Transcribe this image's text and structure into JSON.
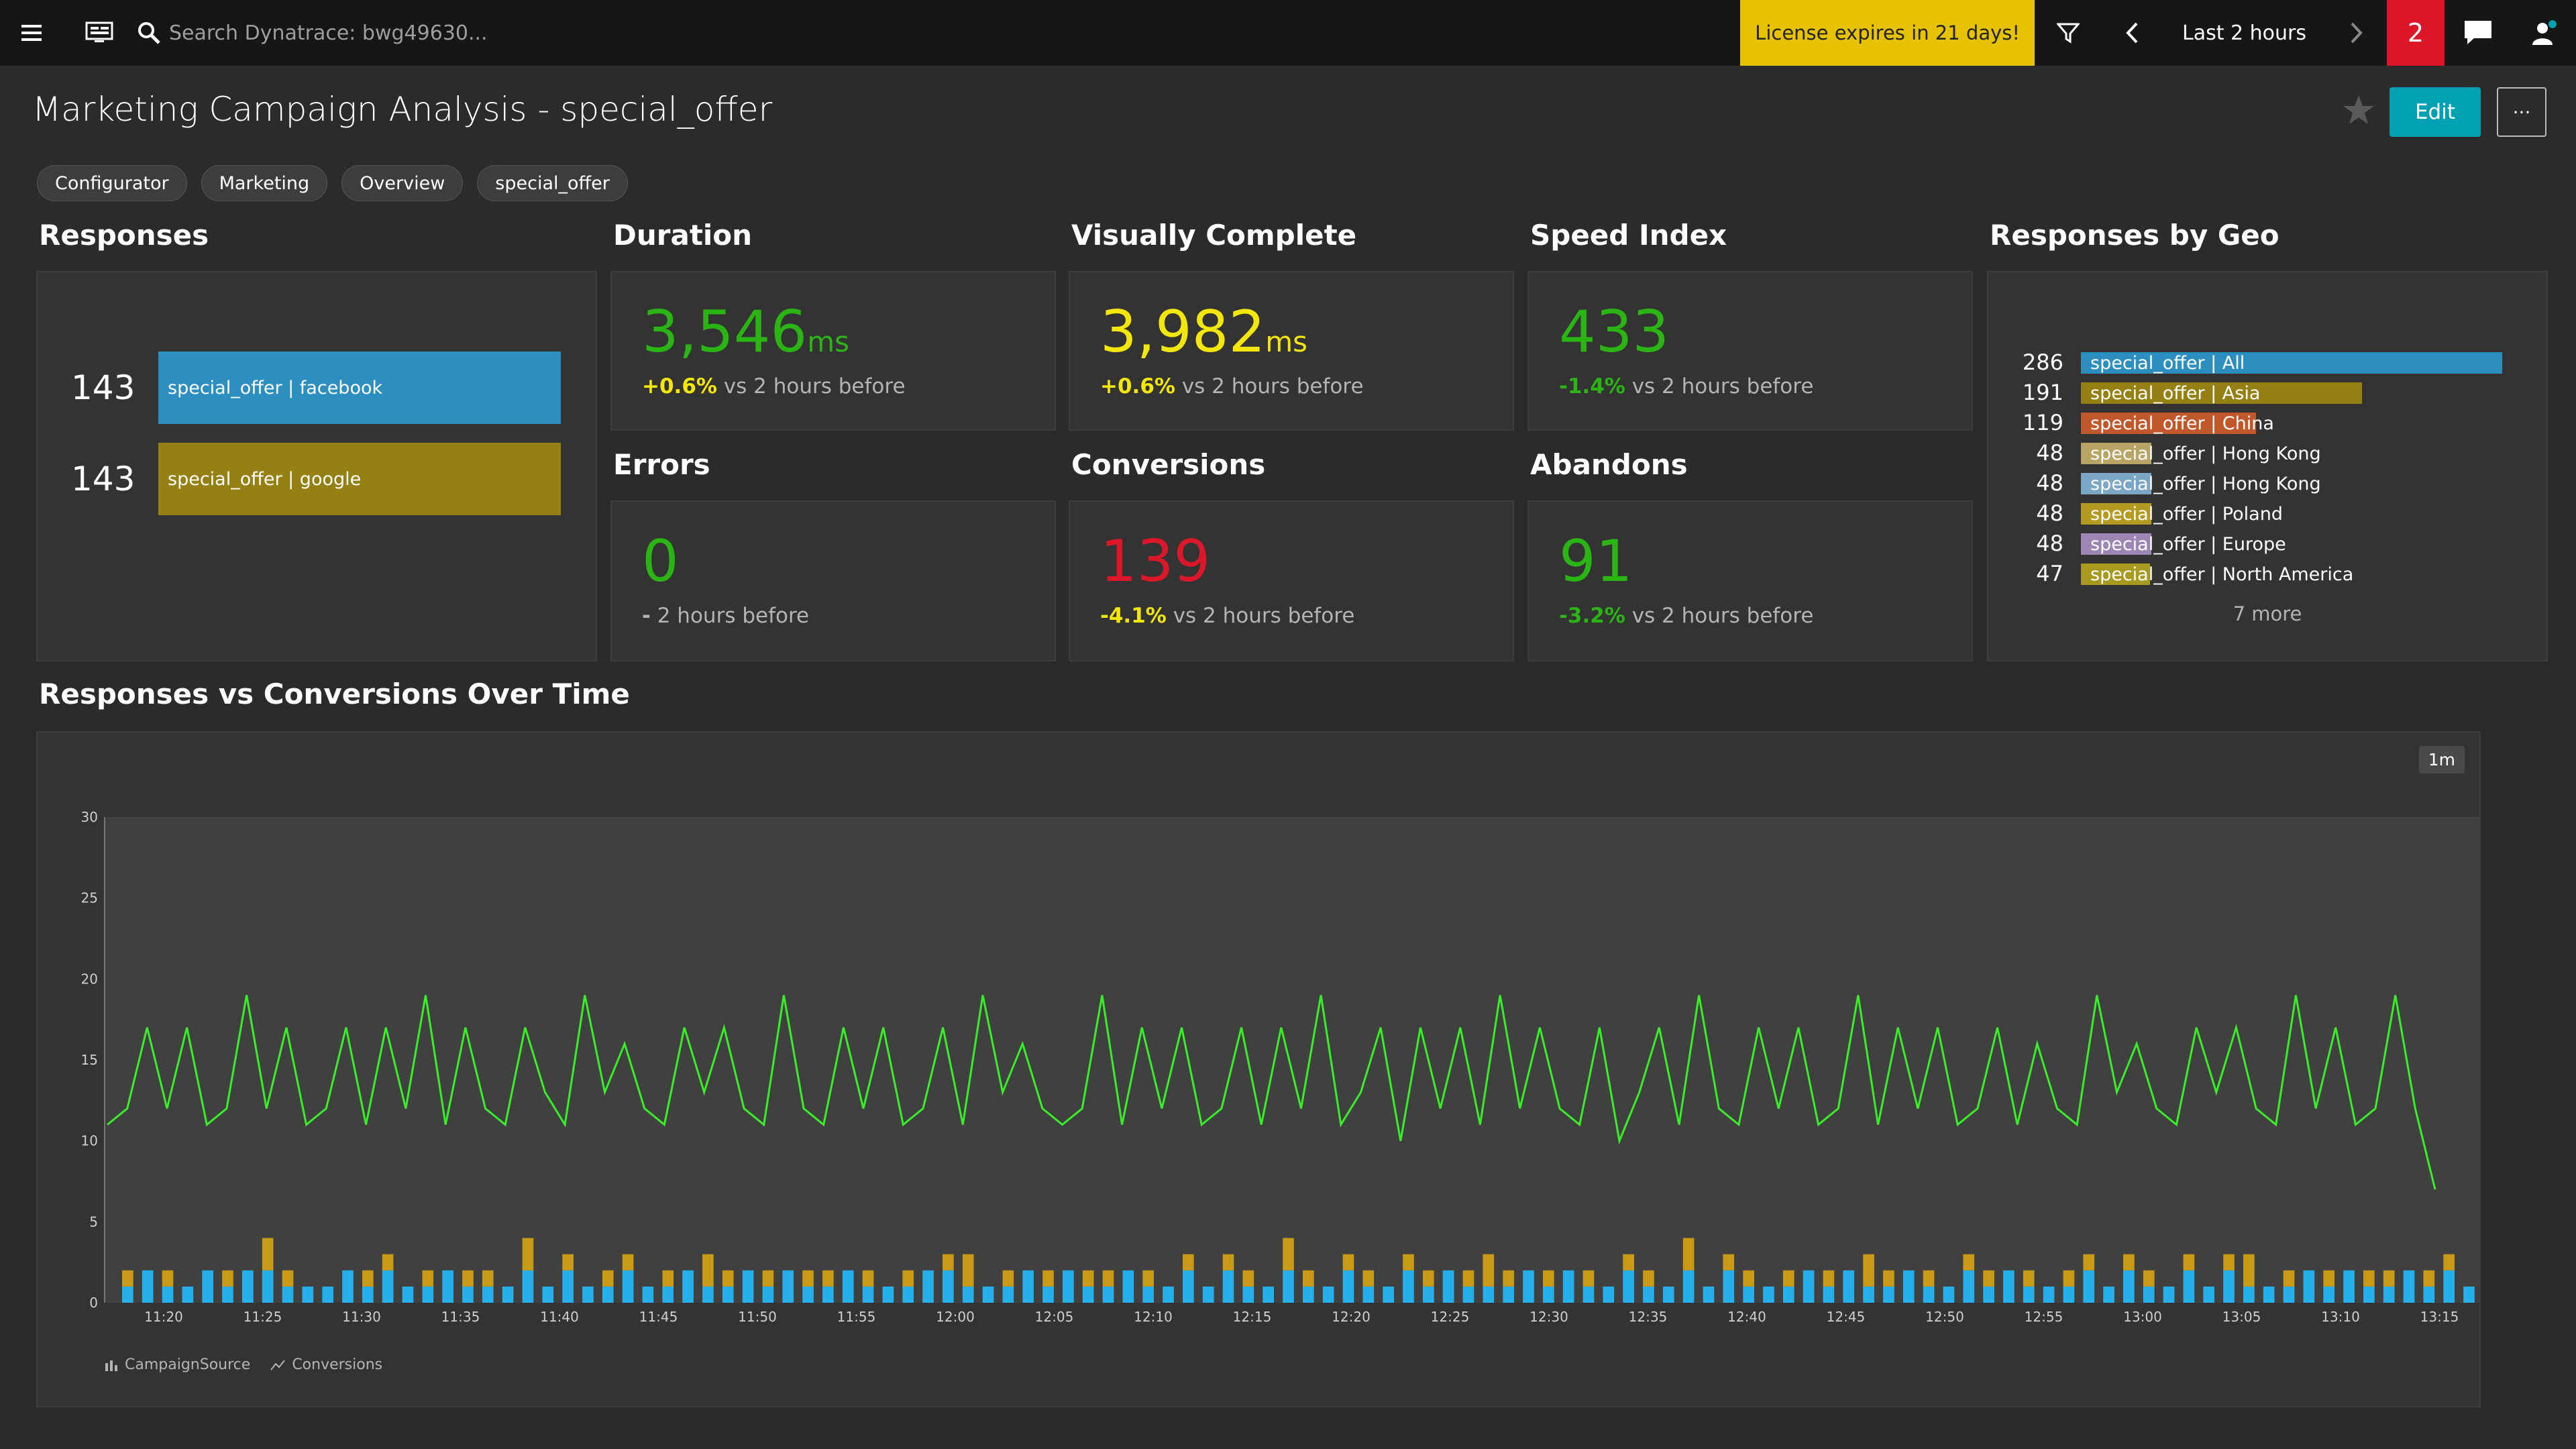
{
  "header": {
    "search_placeholder": "Search Dynatrace: bwg49630...",
    "license_text": "License expires in 21 days!",
    "timeframe": "Last 2 hours",
    "notification_count": "2"
  },
  "page": {
    "title": "Marketing Campaign Analysis - special_offer",
    "edit_label": "Edit",
    "more_label": "···",
    "tags": [
      "Configurator",
      "Marketing",
      "Overview",
      "special_offer"
    ]
  },
  "colors": {
    "accent": "#00a1b2",
    "green": "#2ab515",
    "yellow": "#f3e60b",
    "red": "#dc172a",
    "license": "#e6c200",
    "bar_blue": "#2d8fbf",
    "bar_gold": "#958013"
  },
  "responses": {
    "title": "Responses",
    "rows": [
      {
        "count": "143",
        "label": "special_offer | facebook",
        "color": "#2d8fbf"
      },
      {
        "count": "143",
        "label": "special_offer | google",
        "color": "#958013"
      }
    ]
  },
  "metrics": {
    "duration": {
      "title": "Duration",
      "value": "3,546",
      "unit": "ms",
      "delta": "+0.6%",
      "delta_text": "vs 2 hours before",
      "value_color": "#2ab515",
      "delta_color": "#f3e60b"
    },
    "visually_complete": {
      "title": "Visually Complete",
      "value": "3,982",
      "unit": "ms",
      "delta": "+0.6%",
      "delta_text": "vs 2 hours before",
      "value_color": "#f3e60b",
      "delta_color": "#f3e60b"
    },
    "speed_index": {
      "title": "Speed Index",
      "value": "433",
      "unit": "",
      "delta": "-1.4%",
      "delta_text": "vs 2 hours before",
      "value_color": "#2ab515",
      "delta_color": "#2ab515"
    },
    "errors": {
      "title": "Errors",
      "value": "0",
      "unit": "",
      "delta": "-",
      "delta_text": "2 hours before",
      "value_color": "#2ab515",
      "delta_color": "#b4b4b4"
    },
    "conversions": {
      "title": "Conversions",
      "value": "139",
      "unit": "",
      "delta": "-4.1%",
      "delta_text": "vs 2 hours before",
      "value_color": "#dc172a",
      "delta_color": "#f3e60b"
    },
    "abandons": {
      "title": "Abandons",
      "value": "91",
      "unit": "",
      "delta": "-3.2%",
      "delta_text": "vs 2 hours before",
      "value_color": "#2ab515",
      "delta_color": "#2ab515"
    }
  },
  "geo": {
    "title": "Responses by Geo",
    "more": "7 more",
    "rows": [
      {
        "count": "286",
        "label": "special_offer | All",
        "value": 286,
        "color": "#2d8fbf"
      },
      {
        "count": "191",
        "label": "special_offer | Asia",
        "value": 191,
        "color": "#958013"
      },
      {
        "count": "119",
        "label": "special_offer | China",
        "value": 119,
        "color": "#c1582b"
      },
      {
        "count": "48",
        "label": "special_offer | Hong Kong",
        "value": 48,
        "color": "#b8a566"
      },
      {
        "count": "48",
        "label": "special_offer | Hong Kong",
        "value": 48,
        "color": "#7ba7c4"
      },
      {
        "count": "48",
        "label": "special_offer | Poland",
        "value": 48,
        "color": "#b49a1f"
      },
      {
        "count": "48",
        "label": "special_offer | Europe",
        "value": 48,
        "color": "#9d86b4"
      },
      {
        "count": "47",
        "label": "special_offer | North America",
        "value": 47,
        "color": "#a89a1f"
      }
    ]
  },
  "chart_section": {
    "title": "Responses vs Conversions Over Time",
    "resolution": "1m",
    "legend": [
      "CampaignSource",
      "Conversions"
    ]
  },
  "chart_data": {
    "type": "bar",
    "ylim": [
      0,
      30
    ],
    "yticks": [
      0,
      5,
      10,
      15,
      20,
      25,
      30
    ],
    "xticks": [
      "11:20",
      "11:25",
      "11:30",
      "11:35",
      "11:40",
      "11:45",
      "11:50",
      "11:55",
      "12:00",
      "12:05",
      "12:10",
      "12:15",
      "12:20",
      "12:25",
      "12:30",
      "12:35",
      "12:40",
      "12:45",
      "12:50",
      "12:55",
      "13:00",
      "13:05",
      "13:10",
      "13:15"
    ],
    "series": [
      {
        "name": "CampaignSource",
        "kind": "stacked-bar",
        "colors": [
          "#25b0ec",
          "#c99a15"
        ],
        "blue": [
          1,
          2,
          1,
          1,
          2,
          1,
          2,
          2,
          1,
          1,
          1,
          2,
          1,
          2,
          1,
          1,
          2,
          1,
          1,
          1,
          2,
          1,
          2,
          1,
          1,
          2,
          1,
          1,
          2,
          1,
          1,
          2,
          1,
          2,
          1,
          1,
          2,
          1,
          1,
          1,
          2,
          2,
          1,
          1,
          1,
          2,
          1,
          2,
          1,
          1,
          2,
          1,
          1,
          2,
          1,
          2,
          1,
          1,
          2,
          1,
          1,
          2,
          1,
          1,
          2,
          1,
          2,
          1,
          1,
          1,
          2,
          1,
          2,
          1,
          1,
          2,
          1,
          1,
          2,
          1,
          2,
          1,
          1,
          1,
          2,
          1,
          2,
          1,
          1,
          2,
          1,
          1,
          2,
          1,
          2,
          1,
          1,
          1,
          2,
          1,
          2,
          1,
          1,
          2,
          1,
          2,
          1,
          1,
          1,
          2,
          1,
          2,
          1,
          1,
          2,
          1,
          2,
          1
        ],
        "gold": [
          1,
          0,
          1,
          0,
          0,
          1,
          0,
          2,
          1,
          0,
          0,
          0,
          1,
          1,
          0,
          1,
          0,
          1,
          1,
          0,
          2,
          0,
          1,
          0,
          1,
          1,
          0,
          1,
          0,
          2,
          1,
          0,
          1,
          0,
          1,
          1,
          0,
          1,
          0,
          1,
          0,
          1,
          2,
          0,
          1,
          0,
          1,
          0,
          1,
          1,
          0,
          1,
          0,
          1,
          0,
          1,
          1,
          0,
          2,
          1,
          0,
          1,
          1,
          0,
          1,
          1,
          0,
          1,
          2,
          1,
          0,
          1,
          0,
          1,
          0,
          1,
          1,
          0,
          2,
          0,
          1,
          1,
          0,
          1,
          0,
          1,
          0,
          2,
          1,
          0,
          1,
          0,
          1,
          1,
          0,
          1,
          0,
          1,
          1,
          0,
          1,
          1,
          0,
          1,
          0,
          1,
          2,
          0,
          1,
          0,
          1,
          0,
          1,
          1,
          0,
          1,
          1,
          0
        ]
      },
      {
        "name": "Conversions",
        "kind": "line",
        "color": "#38ef27",
        "values": [
          11,
          12,
          17,
          12,
          17,
          11,
          12,
          19,
          12,
          17,
          11,
          12,
          17,
          11,
          17,
          12,
          19,
          11,
          17,
          12,
          11,
          17,
          13,
          11,
          19,
          13,
          16,
          12,
          11,
          17,
          13,
          17,
          12,
          11,
          19,
          12,
          11,
          17,
          12,
          17,
          11,
          12,
          17,
          11,
          19,
          13,
          16,
          12,
          11,
          12,
          19,
          11,
          17,
          12,
          17,
          11,
          12,
          17,
          11,
          17,
          12,
          19,
          11,
          13,
          17,
          10,
          17,
          12,
          17,
          11,
          19,
          12,
          17,
          12,
          11,
          17,
          10,
          13,
          17,
          11,
          19,
          12,
          11,
          17,
          12,
          17,
          11,
          12,
          19,
          11,
          17,
          12,
          17,
          11,
          12,
          17,
          11,
          16,
          12,
          11,
          19,
          13,
          16,
          12,
          11,
          17,
          13,
          17,
          12,
          11,
          19,
          12,
          17,
          11,
          12,
          19,
          12,
          7
        ]
      }
    ]
  }
}
